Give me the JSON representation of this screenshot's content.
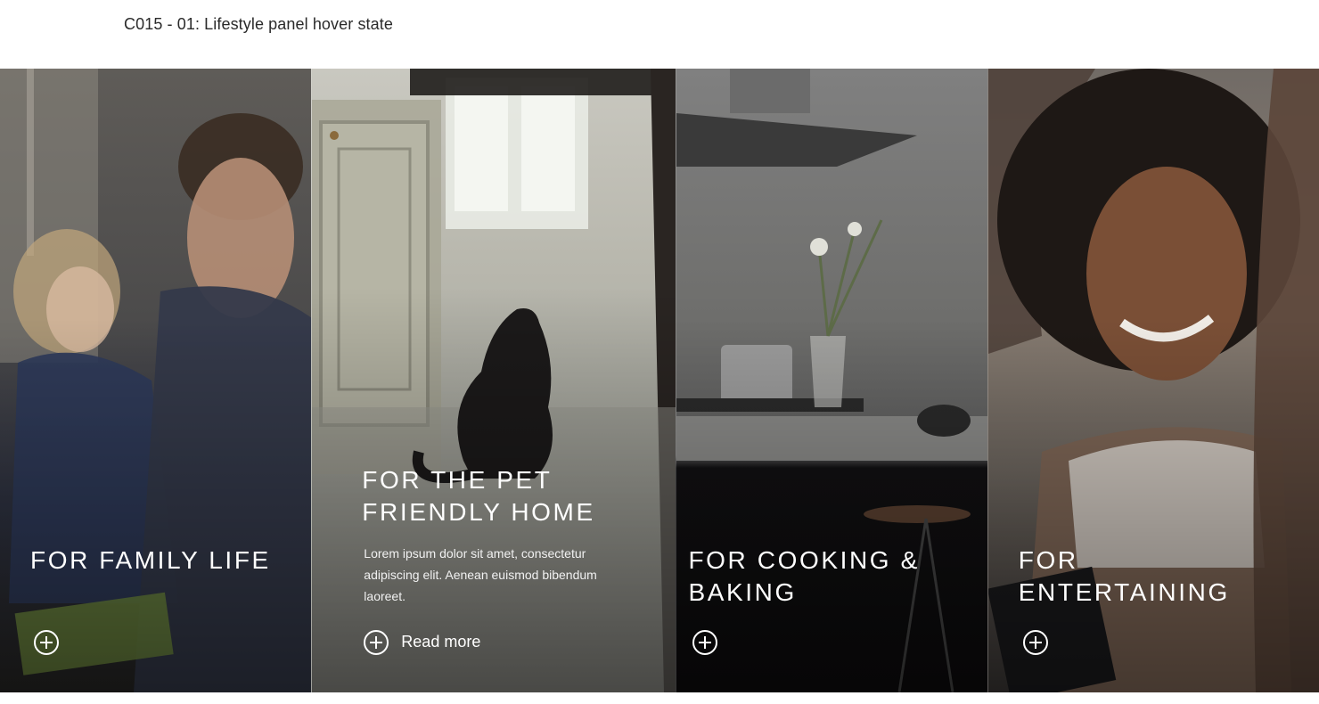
{
  "page": {
    "caption": "C015 - 01: Lifestyle panel hover state"
  },
  "panels": [
    {
      "title": "FOR FAMILY LIFE",
      "icon": "plus-circle-icon"
    },
    {
      "title_line1": "FOR THE PET",
      "title_line2": "FRIENDLY HOME",
      "description": "Lorem ipsum dolor sit amet, consectetur adipiscing elit. Aenean euismod bibendum laoreet.",
      "cta_label": "Read more",
      "icon": "plus-circle-icon",
      "state": "hover"
    },
    {
      "title_line1": "FOR COOKING &",
      "title_line2": "BAKING",
      "icon": "plus-circle-icon"
    },
    {
      "title_line1": "FOR",
      "title_line2": "ENTERTAINING",
      "icon": "plus-circle-icon"
    }
  ]
}
